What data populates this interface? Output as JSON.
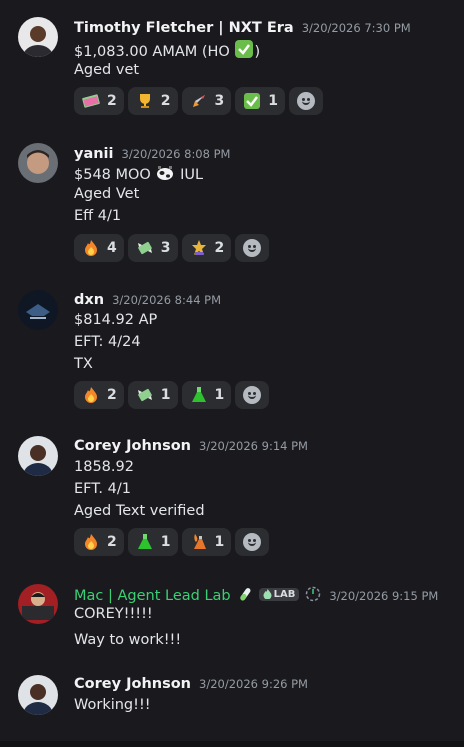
{
  "messages": [
    {
      "author": "Timothy Fletcher | NXT Era",
      "timestamp": "3/20/2026 7:30 PM",
      "lines": [
        "$1,083.00 AMAM (HO",
        "Aged vet"
      ],
      "line1_suffix": ")",
      "reactions": [
        {
          "icon": "cash-emoji",
          "count": "2"
        },
        {
          "icon": "trophy-emoji",
          "count": "2"
        },
        {
          "icon": "rocket-emoji",
          "count": "3"
        },
        {
          "icon": "check-mark-emoji",
          "count": "1"
        }
      ]
    },
    {
      "author": "yanii",
      "timestamp": "3/20/2026 8:08 PM",
      "lines": [
        "$548 MOO",
        "Aged Vet",
        "Eff 4/1"
      ],
      "line1_suffix": "IUL",
      "reactions": [
        {
          "icon": "fire-emoji",
          "count": "4"
        },
        {
          "icon": "money-with-wings-emoji",
          "count": "3"
        },
        {
          "icon": "star-badge-emoji",
          "count": "2"
        }
      ]
    },
    {
      "author": "dxn",
      "timestamp": "3/20/2026 8:44 PM",
      "lines": [
        "$814.92 AP",
        "EFT: 4/24",
        "TX"
      ],
      "reactions": [
        {
          "icon": "fire-emoji",
          "count": "2"
        },
        {
          "icon": "money-with-wings-emoji",
          "count": "1"
        },
        {
          "icon": "green-flask-emoji",
          "count": "1"
        }
      ]
    },
    {
      "author": "Corey Johnson",
      "timestamp": "3/20/2026 9:14 PM",
      "lines": [
        "1858.92",
        "EFT. 4/1",
        "Aged Text verified"
      ],
      "reactions": [
        {
          "icon": "fire-emoji",
          "count": "2"
        },
        {
          "icon": "green-flask-emoji",
          "count": "1"
        },
        {
          "icon": "fire-flask-emoji",
          "count": "1"
        }
      ]
    },
    {
      "author": "Mac | Agent Lead Lab",
      "tag": "LAB",
      "timestamp": "3/20/2026 9:15 PM",
      "lines": [
        "COREY!!!!!",
        "Way to work!!!"
      ]
    },
    {
      "author": "Corey Johnson",
      "timestamp": "3/20/2026 9:26 PM",
      "lines": [
        "Working!!!"
      ]
    }
  ],
  "colors": {
    "background": "#1a1a1e",
    "reaction_bg": "#2b2d31",
    "role_green": "#3ccf72",
    "timestamp": "#949ba4"
  }
}
